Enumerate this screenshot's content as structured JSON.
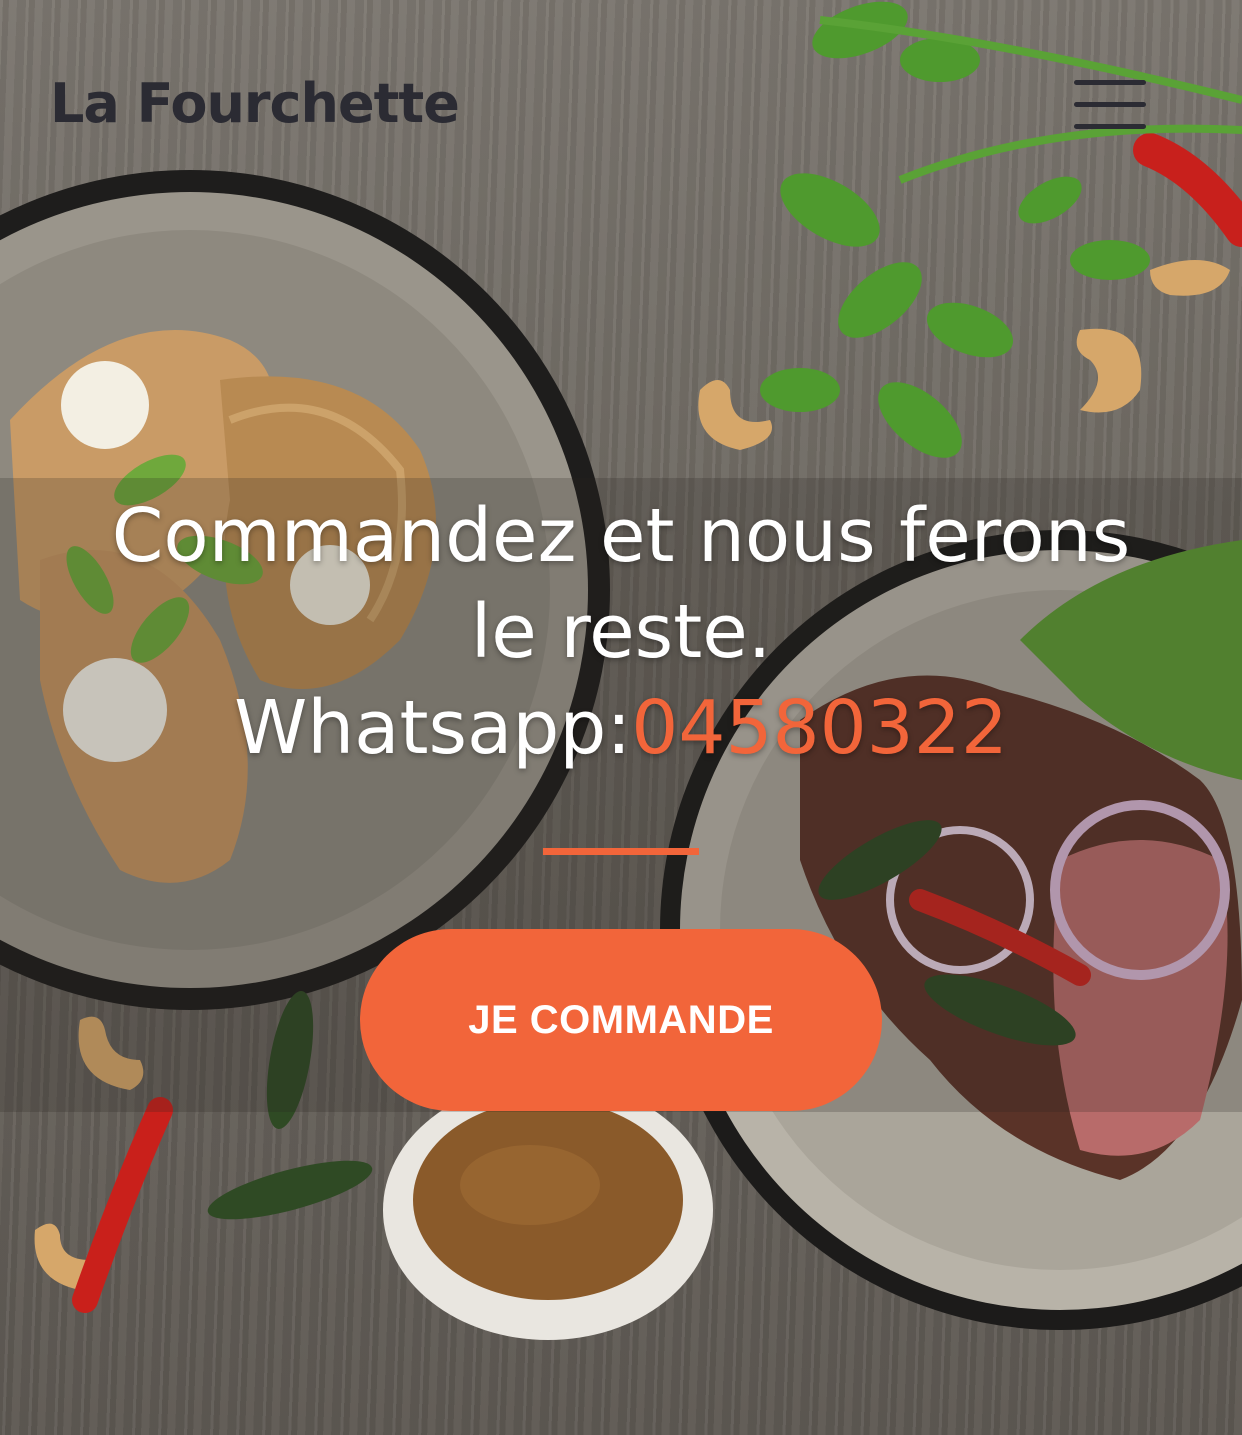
{
  "header": {
    "brand": "La Fourchette"
  },
  "hero": {
    "headline_line1": "Commandez et nous ferons",
    "headline_line2": "le reste.",
    "whatsapp_label": "Whatsapp:",
    "whatsapp_number": "04580322",
    "cta_label": "JE COMMANDE"
  },
  "colors": {
    "accent": "#f2653a",
    "brand_text": "#2b2b33",
    "headline_text": "#ffffff"
  },
  "icons": {
    "menu": "hamburger-menu-icon"
  }
}
